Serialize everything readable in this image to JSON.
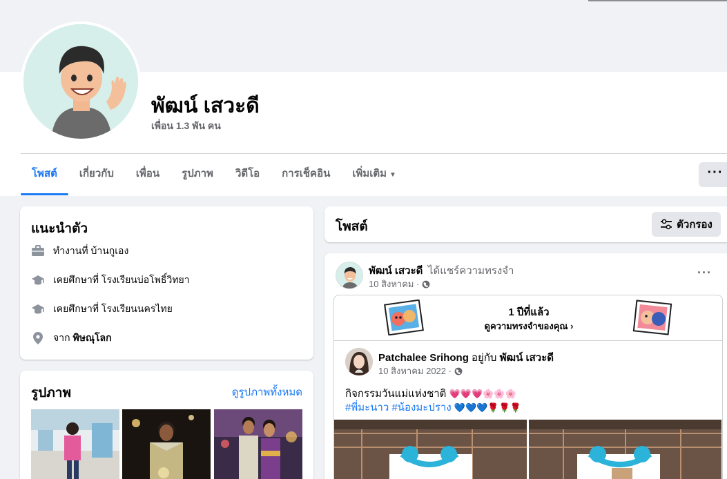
{
  "profile": {
    "name": "พัฒน์ เสวะดี",
    "friends": "เพื่อน 1.3 พัน คน"
  },
  "tabs": [
    {
      "label": "โพสต์",
      "active": true
    },
    {
      "label": "เกี่ยวกับ"
    },
    {
      "label": "เพื่อน"
    },
    {
      "label": "รูปภาพ"
    },
    {
      "label": "วิดีโอ"
    },
    {
      "label": "การเช็คอิน"
    },
    {
      "label": "เพิ่มเติม"
    }
  ],
  "more_button": "···",
  "intro": {
    "title": "แนะนำตัว",
    "work": "ทำงานที่ บ้านกูเอง",
    "education1": "เคยศึกษาที่ โรงเรียนบ่อโพธิ์วิทยา",
    "education2": "เคยศึกษาที่ โรงเรียนนครไทย",
    "from_prefix": "จาก",
    "from_place": "พิษณุโลก"
  },
  "photos": {
    "title": "รูปภาพ",
    "see_all": "ดูรูปภาพทั้งหมด"
  },
  "posts": {
    "title": "โพสต์",
    "filter_label": "ตัวกรอง"
  },
  "post": {
    "author": "พัฒน์ เสวะดี",
    "action": "ได้แชร์ความทรงจำ",
    "date": "10 สิงหาคม ·",
    "menu": "···",
    "memory": {
      "years_ago": "1 ปีที่แล้ว",
      "see_memories": "ดูความทรงจำของคุณ"
    },
    "shared": {
      "author": "Patchalee Srihong",
      "with_word": "อยู่กับ",
      "with_name": "พัฒน์ เสวะดี",
      "date": "10 สิงหาคม 2022 ·",
      "text": "กิจกรรมวันแม่แห่งชาติ",
      "emojis_hearts": "💗💗💗🌸🌸🌸",
      "tags": "#พี่มะนาว #น้องมะปราง",
      "emojis_tail": "💙💙💙🌹🌹🌹"
    }
  },
  "colors": {
    "accent": "#1877f2",
    "background": "#f0f2f5",
    "secondary_text": "#65676b"
  }
}
